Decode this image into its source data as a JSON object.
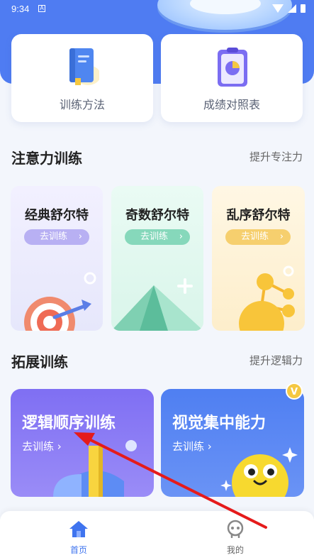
{
  "status_bar": {
    "time": "9:34",
    "indicator": "A"
  },
  "top_cards": [
    {
      "label": "训练方法",
      "icon": "book-icon"
    },
    {
      "label": "成绩对照表",
      "icon": "clipboard-chart-icon"
    }
  ],
  "attention_section": {
    "title": "注意力训练",
    "link": "提升专注力",
    "cards": [
      {
        "title": "经典舒尔特",
        "button": "去训练",
        "chevron": "›"
      },
      {
        "title": "奇数舒尔特",
        "button": "去训练",
        "chevron": "›"
      },
      {
        "title": "乱序舒尔特",
        "button": "去训练",
        "chevron": "›"
      }
    ]
  },
  "extend_section": {
    "title": "拓展训练",
    "link": "提升逻辑力",
    "cards": [
      {
        "title": "逻辑顺序训练",
        "sub": "去训练 ›"
      },
      {
        "title": "视觉集中能力",
        "sub": "去训练 ›"
      }
    ],
    "vip_badge": "V"
  },
  "tabbar": {
    "home": "首页",
    "mine": "我的"
  },
  "colors": {
    "header_blue": "#4f7cf2",
    "tab_active": "#3f74ef",
    "annotation_arrow": "#e51b1b"
  }
}
